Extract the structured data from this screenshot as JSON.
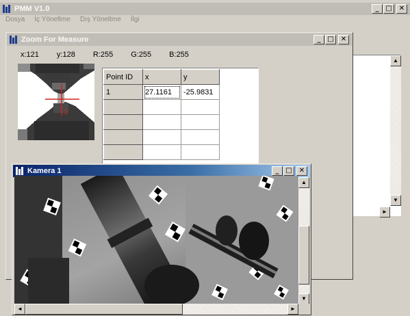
{
  "main_window": {
    "title": "PMM V1.0"
  },
  "menu": [
    "Dosya",
    "İç Yöneltme",
    "Dış Yöneltme",
    "İlgi"
  ],
  "zoom_window": {
    "title": "Zoom For Measure",
    "pixel_info": {
      "x": "x:121",
      "y": "y:128",
      "r": "R:255",
      "g": "G:255",
      "b": "B:255"
    },
    "crosshair_label": "1",
    "table": {
      "headers": [
        "Point ID",
        "x",
        "y"
      ],
      "rows": [
        [
          "1",
          "27.1161",
          "-25.9831"
        ],
        [
          "",
          "",
          ""
        ],
        [
          "",
          "",
          ""
        ],
        [
          "",
          "",
          ""
        ],
        [
          "",
          "",
          ""
        ]
      ]
    }
  },
  "camera_window": {
    "title": "Kamera 1"
  },
  "controls": {
    "minimize": "_",
    "maximize": "□",
    "close": "✕"
  },
  "scroll": {
    "up": "▲",
    "down": "▼",
    "left": "◄",
    "right": "►"
  },
  "colors": {
    "active_title": "#0a246a",
    "inactive_title": "#c0bdb6",
    "face": "#d4d0c8"
  }
}
